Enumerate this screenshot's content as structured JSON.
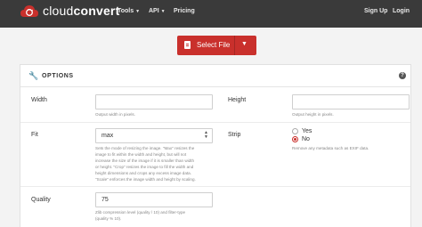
{
  "brand": {
    "name_prefix": "cloud",
    "name_suffix": "convert"
  },
  "nav": {
    "tools": "Tools",
    "api": "API",
    "pricing": "Pricing",
    "signup": "Sign Up",
    "login": "Login"
  },
  "upload": {
    "select_label": "Select File"
  },
  "options": {
    "title": "OPTIONS",
    "width": {
      "label": "Width",
      "value": "",
      "help": "Output width in pixels."
    },
    "height": {
      "label": "Height",
      "value": "",
      "help": "Output height in pixels."
    },
    "fit": {
      "label": "Fit",
      "value": "max",
      "help_lines": [
        "Sets the mode of resizing the image. \"Max\" resizes the",
        "image to fit within the width and height, but will not",
        "increase the size of the image if it is smaller than width",
        "or height. \"Crop\" resizes the image to fill the width and",
        "height dimensions and crops any excess image data.",
        "\"Scale\" enforces the image width and height by scaling."
      ]
    },
    "strip": {
      "label": "Strip",
      "yes": "Yes",
      "no": "No",
      "selected": "No",
      "help": "Remove any metadata such as EXIF data."
    },
    "quality": {
      "label": "Quality",
      "value": "75",
      "help_lines": [
        "Zlib compression level (quality / 10) and filter-type",
        "(quality % 10)."
      ]
    }
  },
  "colors": {
    "accent": "#c9302c",
    "topbar": "#3a3a3a"
  }
}
